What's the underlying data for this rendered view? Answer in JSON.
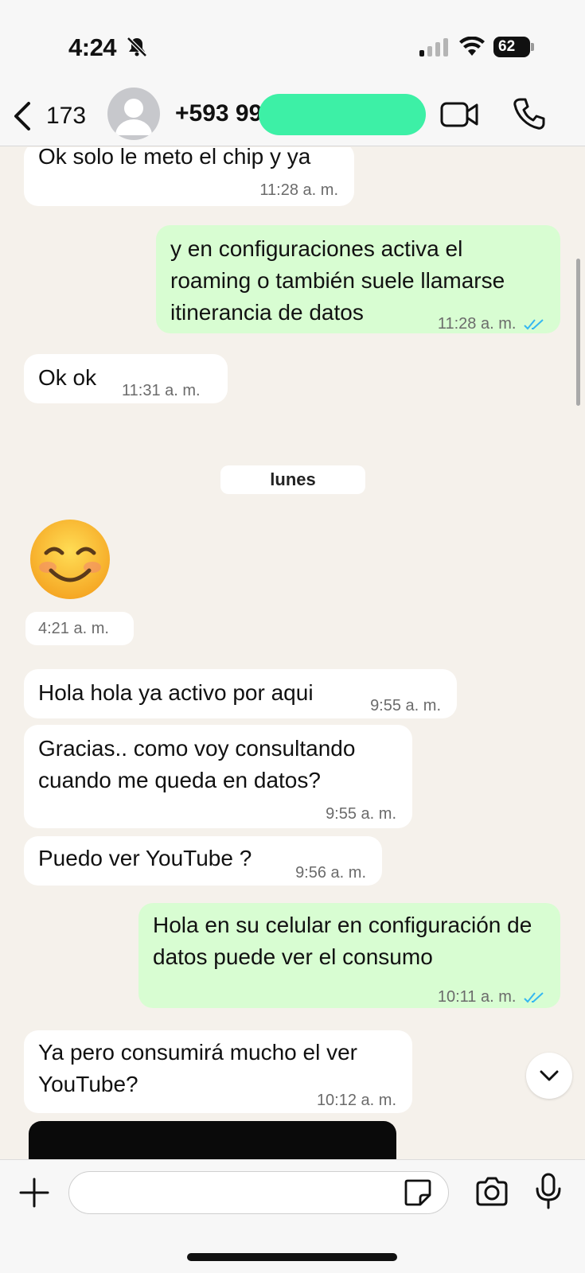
{
  "status_bar": {
    "time": "4:24",
    "battery": "62"
  },
  "header": {
    "back_count": "173",
    "contact_name": "+593 99",
    "icons": {
      "back": "chevron-left-icon",
      "avatar": "person-icon",
      "video": "video-camera-icon",
      "call": "phone-icon"
    }
  },
  "messages": [
    {
      "direction": "in",
      "text": "Ok solo le meto el chip y ya",
      "time": "11:28 a. m."
    },
    {
      "direction": "out",
      "text": "y en configuraciones activa el roaming o también suele llamarse itinerancia de datos",
      "time": "11:28 a. m.",
      "read": true
    },
    {
      "direction": "in",
      "text": "Ok ok",
      "time": "11:31 a. m."
    },
    {
      "direction": "day",
      "text": "lunes"
    },
    {
      "direction": "in",
      "emoji": "smiling-face-with-smiling-eyes",
      "time": "4:21 a. m."
    },
    {
      "direction": "in",
      "text": "Hola hola ya activo por aqui",
      "time": "9:55 a. m."
    },
    {
      "direction": "in",
      "text": "Gracias.. como voy consultando cuando me queda en datos?",
      "time": "9:55 a. m."
    },
    {
      "direction": "in",
      "text": "Puedo ver YouTube ?",
      "time": "9:56 a. m."
    },
    {
      "direction": "out",
      "text": "Hola en su celular en configuración de datos puede ver el consumo",
      "time": "10:11 a. m.",
      "read": true
    },
    {
      "direction": "in",
      "text": "Ya pero consumirá mucho el ver YouTube?",
      "time": "10:12 a. m."
    }
  ],
  "composer": {
    "placeholder": "",
    "icons": [
      "plus-icon",
      "sticker-icon",
      "camera-icon",
      "microphone-icon"
    ]
  },
  "colors": {
    "incoming_bubble": "#ffffff",
    "outgoing_bubble": "#d8fdd2",
    "chat_background": "#f5f1eb",
    "read_ticks": "#34b7f1",
    "redaction": "#3df0a6"
  }
}
